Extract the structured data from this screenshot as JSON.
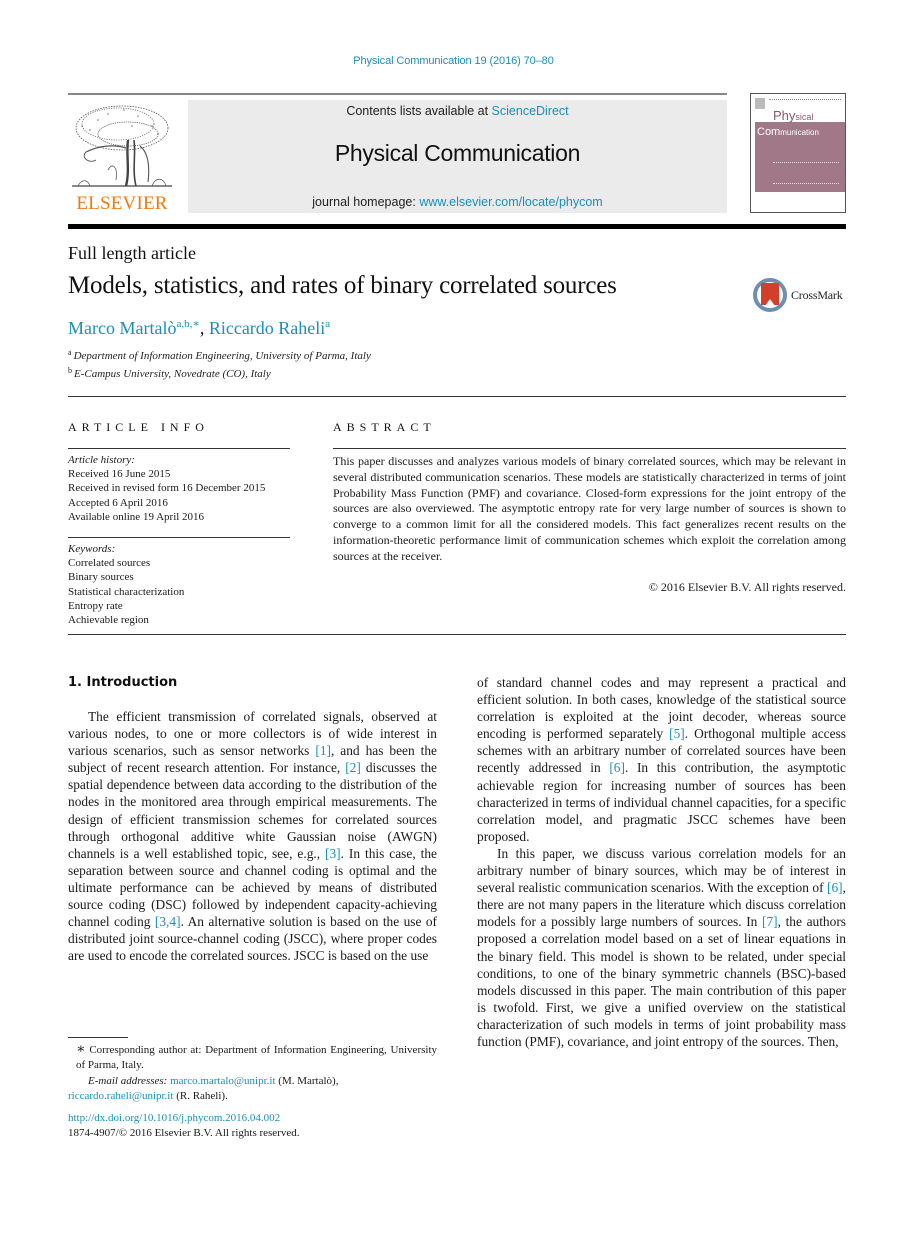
{
  "header": {
    "running_head": "Physical Communication 19 (2016) 70–80",
    "publisher": "ELSEVIER",
    "contents_prefix": "Contents lists available at ",
    "contents_link": "ScienceDirect",
    "journal_title": "Physical Communication",
    "homepage_prefix": "journal homepage: ",
    "homepage_link": "www.elsevier.com/locate/phycom",
    "cover": {
      "line1_big": "Phy",
      "line1_small": "sical",
      "line2_big": "Com",
      "line2_small": "munication"
    }
  },
  "article": {
    "type": "Full length article",
    "title": "Models, statistics, and rates of binary correlated sources",
    "crossmark_label": "CrossMark",
    "authors": [
      {
        "name": "Marco Martalò",
        "affil": "a,b,∗"
      },
      {
        "name": "Riccardo Raheli",
        "affil": "a"
      }
    ],
    "author_separator": ", ",
    "affiliations": [
      {
        "key": "a",
        "text": "Department of Information Engineering, University of Parma, Italy"
      },
      {
        "key": "b",
        "text": "E-Campus University, Novedrate (CO), Italy"
      }
    ]
  },
  "article_info": {
    "heading": "ARTICLE INFO",
    "history_label": "Article history:",
    "history": [
      "Received 16 June 2015",
      "Received in revised form 16 December 2015",
      "Accepted 6 April 2016",
      "Available online 19 April 2016"
    ],
    "keywords_label": "Keywords:",
    "keywords": [
      "Correlated sources",
      "Binary sources",
      "Statistical characterization",
      "Entropy rate",
      "Achievable region"
    ]
  },
  "abstract": {
    "heading": "ABSTRACT",
    "text": "This paper discusses and analyzes various models of binary correlated sources, which may be relevant in several distributed communication scenarios. These models are statistically characterized in terms of joint Probability Mass Function (PMF) and covariance. Closed-form expressions for the joint entropy of the sources are also overviewed. The asymptotic entropy rate for very large number of sources is shown to converge to a common limit for all the considered models. This fact generalizes recent results on the information-theoretic performance limit of communication schemes which exploit the correlation among sources at the receiver.",
    "copyright": "© 2016 Elsevier B.V. All rights reserved."
  },
  "body": {
    "section_heading": "1.  Introduction",
    "left_col": {
      "p1": [
        "The efficient transmission of correlated signals, observed at various nodes, to one or more collectors is of wide interest in various scenarios, such as sensor networks ",
        "[1]",
        ", and has been the subject of recent research attention. For instance, ",
        "[2]",
        " discusses the spatial dependence between data according to the distribution of the nodes in the monitored area through empirical measurements. The design of efficient transmission schemes for correlated sources through orthogonal additive white Gaussian noise (AWGN) channels is a well established topic, see, e.g., ",
        "[3]",
        ". In this case, the separation between source and channel coding is optimal and the ultimate performance can be achieved by means of distributed source coding (DSC) followed by independent capacity-achieving channel coding ",
        "[3,4]",
        ". An alternative solution is based on the use of distributed joint source-channel coding (JSCC), where proper codes are used to encode the correlated sources. JSCC is based on the use"
      ]
    },
    "right_col": {
      "p1": [
        "of standard channel codes and may represent a practical and efficient solution. In both cases, knowledge of the statistical source correlation is exploited at the joint decoder, whereas source encoding is performed separately ",
        "[5]",
        ". Orthogonal multiple access schemes with an arbitrary number of correlated sources have been recently addressed in ",
        "[6]",
        ". In this contribution, the asymptotic achievable region for increasing number of sources has been characterized in terms of individual channel capacities, for a specific correlation model, and pragmatic JSCC schemes have been proposed."
      ],
      "p2": [
        "In this paper, we discuss various correlation models for an arbitrary number of binary sources, which may be of interest in several realistic communication scenarios. With the exception of ",
        "[6]",
        ", there are not many papers in the literature which discuss correlation models for a possibly large numbers of sources. In ",
        "[7]",
        ", the authors proposed a correlation model based on a set of linear equations in the binary field. This model is shown to be related, under special conditions, to one of the binary symmetric channels (BSC)-based models discussed in this paper. The main contribution of this paper is twofold. First, we give a unified overview on the statistical characterization of such models in terms of joint probability mass function (PMF), covariance, and joint entropy of the sources. Then,"
      ]
    }
  },
  "footnotes": {
    "star": "∗",
    "corresponding": "Corresponding author at: Department of Information Engineering, University of Parma, Italy.",
    "email_label": "E-mail addresses:",
    "emails": [
      {
        "address": "marco.martalo@unipr.it",
        "owner": " (M. Martalò),"
      },
      {
        "address": "riccardo.raheli@unipr.it",
        "owner": " (R. Raheli)."
      }
    ],
    "doi": "http://dx.doi.org/10.1016/j.phycom.2016.04.002",
    "issn": "1874-4907/© 2016 Elsevier B.V. All rights reserved."
  }
}
